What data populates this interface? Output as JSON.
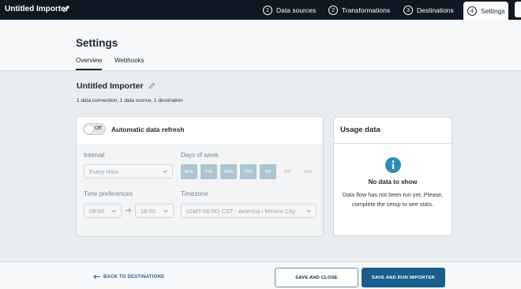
{
  "app": {
    "title": "Untitled Importer"
  },
  "steps": [
    {
      "number": "1",
      "label": "Data sources"
    },
    {
      "number": "2",
      "label": "Transformations"
    },
    {
      "number": "3",
      "label": "Destinations"
    },
    {
      "number": "4",
      "label": "Settings"
    }
  ],
  "header": {
    "title": "Settings",
    "tabs": [
      {
        "label": "Overview"
      },
      {
        "label": "Webhooks"
      }
    ]
  },
  "importer": {
    "name": "Untitled Importer",
    "summary": "1 data connection, 1 data source, 1 destination"
  },
  "refresh": {
    "toggle_state": "Off",
    "label": "Automatic data refresh",
    "interval_label": "Interval",
    "interval_value": "Every Hour",
    "days_label": "Days of week",
    "days": [
      {
        "label": "MON",
        "selected": true
      },
      {
        "label": "TUE",
        "selected": true
      },
      {
        "label": "WED",
        "selected": true
      },
      {
        "label": "THU",
        "selected": true
      },
      {
        "label": "FRI",
        "selected": true
      },
      {
        "label": "SAT",
        "selected": false
      },
      {
        "label": "SUN",
        "selected": false
      }
    ],
    "time_label": "Time preferences",
    "time_start": "09:00",
    "time_end": "18:00",
    "timezone_label": "Timezone",
    "timezone_value": "(GMT-06:00) CST - America / Mexico City"
  },
  "usage": {
    "title": "Usage data",
    "empty_title": "No data to show",
    "empty_message": "Data flow has not been run yet. Please, complete the setup to see stats."
  },
  "footer": {
    "back_label": "BACK TO DESTINATIONS",
    "save_close_label": "SAVE AND CLOSE",
    "save_run_label": "SAVE AND RUN IMPORTER"
  },
  "colors": {
    "topbar": "#0f1923",
    "accent": "#1a5e8c",
    "info": "#2a8cbd",
    "day_selected": "#adc4d1"
  },
  "icons": {
    "title_edit": "pencil-icon",
    "importer_edit": "pencil-icon",
    "info": "info-icon",
    "back": "arrow-left-icon",
    "time_arrow": "arrow-right-icon",
    "select": "chevron-down-icon"
  }
}
